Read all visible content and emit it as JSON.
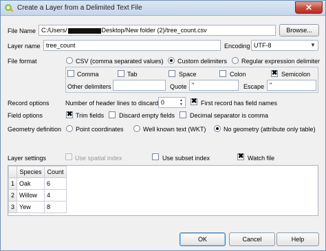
{
  "window": {
    "title": "Create a Layer from a Delimited Text File",
    "close_glyph": "✕"
  },
  "file_name": {
    "label": "File Name",
    "value_prefix": "C:/Users/",
    "value_suffix": "Desktop/New folder (2)/tree_count.csv",
    "browse_label": "Browse..."
  },
  "layer_name": {
    "label": "Layer name",
    "value": "tree_count"
  },
  "encoding": {
    "label": "Encoding",
    "value": "UTF-8"
  },
  "file_format": {
    "label": "File format",
    "options": [
      {
        "label": "CSV (comma separated values)",
        "selected": false
      },
      {
        "label": "Custom delimiters",
        "selected": true
      },
      {
        "label": "Regular expression delimiter",
        "selected": false
      }
    ]
  },
  "delimiters": {
    "comma": {
      "label": "Comma",
      "checked": false
    },
    "tab": {
      "label": "Tab",
      "checked": false
    },
    "space": {
      "label": "Space",
      "checked": false
    },
    "colon": {
      "label": "Colon",
      "checked": false
    },
    "semicolon": {
      "label": "Semicolon",
      "checked": true
    },
    "other_label": "Other delimiters",
    "other_value": "",
    "quote_label": "Quote",
    "quote_value": "\"",
    "escape_label": "Escape",
    "escape_value": "\""
  },
  "record_options": {
    "label": "Record options",
    "header_lines_label": "Number of header lines to discard",
    "header_lines_value": "0",
    "first_record_label": "First record has field names",
    "first_record_checked": true
  },
  "field_options": {
    "label": "Field options",
    "trim_label": "Trim fields",
    "trim_checked": true,
    "discard_label": "Discard empty fields",
    "discard_checked": false,
    "decimal_label": "Decimal separator is comma",
    "decimal_checked": false
  },
  "geometry": {
    "label": "Geometry definition",
    "options": [
      {
        "label": "Point coordinates",
        "selected": false
      },
      {
        "label": "Well known text (WKT)",
        "selected": false
      },
      {
        "label": "No geometry (attribute only table)",
        "selected": true
      }
    ]
  },
  "layer_settings": {
    "label": "Layer settings",
    "spatial_index_label": "Use spatial index",
    "spatial_index_checked": false,
    "subset_index_label": "Use subset index",
    "subset_index_checked": false,
    "watch_file_label": "Watch file",
    "watch_file_checked": true
  },
  "preview": {
    "columns": [
      "Species",
      "Count"
    ],
    "rows": [
      {
        "num": "1",
        "cells": [
          "Oak",
          "6"
        ]
      },
      {
        "num": "2",
        "cells": [
          "Willow",
          "4"
        ]
      },
      {
        "num": "3",
        "cells": [
          "Yew",
          "8"
        ]
      }
    ]
  },
  "buttons": {
    "ok": "OK",
    "cancel": "Cancel",
    "help": "Help"
  },
  "icons": {
    "title_icon": "qgis-logo-icon",
    "check_mark": "✖"
  }
}
